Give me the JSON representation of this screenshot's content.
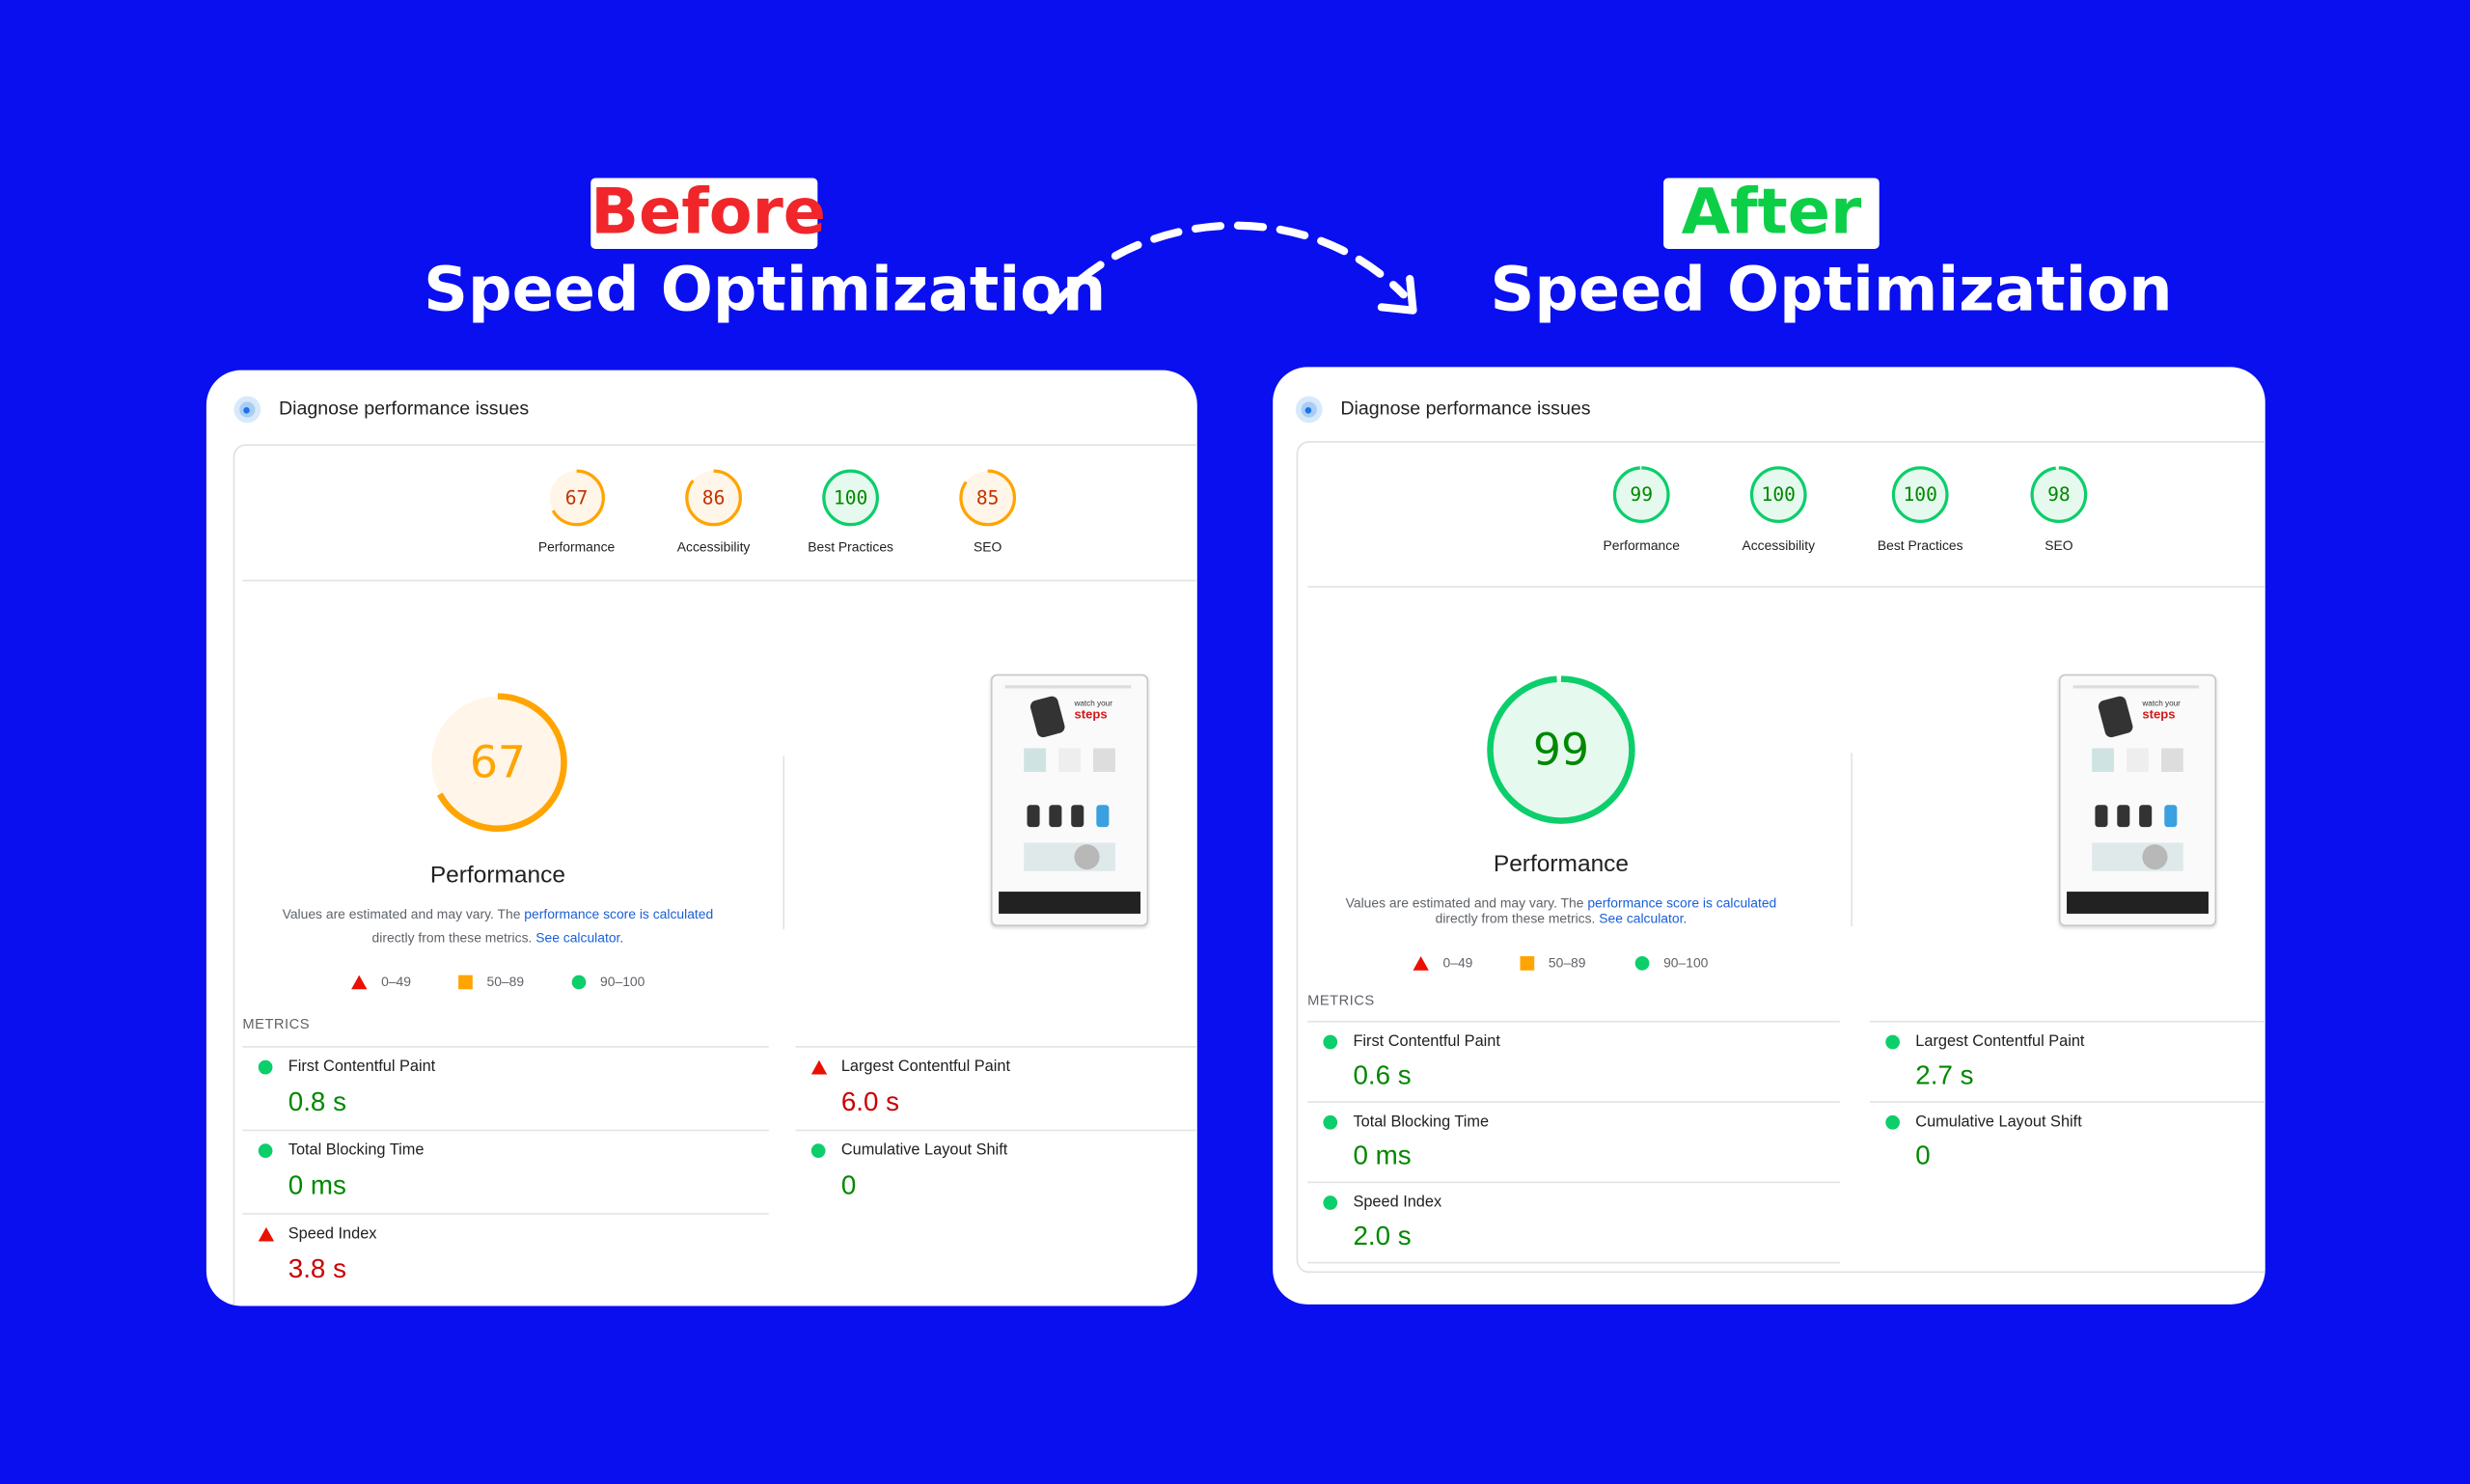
{
  "colors": {
    "background": "#0a0ff0",
    "before_badge": "#f0262b",
    "after_badge": "#0ccf47",
    "good": "#0cce6b",
    "average": "#ffa400",
    "poor": "#eb0f00",
    "good_text": "#008800",
    "poor_text": "#cc0000",
    "average_text": "#c33300",
    "link": "#1a5fd6"
  },
  "banner": {
    "before_badge": "Before",
    "before_title": "Speed Optimization",
    "after_badge": "After",
    "after_title": "Speed Optimization",
    "arrow_icon": "dashed-curved-arrow"
  },
  "before": {
    "header": "Diagnose performance issues",
    "header_icon": "pagespeed-icon",
    "categories": [
      {
        "label": "Performance",
        "score": 67,
        "status": "average"
      },
      {
        "label": "Accessibility",
        "score": 86,
        "status": "average"
      },
      {
        "label": "Best Practices",
        "score": 100,
        "status": "good"
      },
      {
        "label": "SEO",
        "score": 85,
        "status": "average"
      }
    ],
    "main_score": 67,
    "main_status": "average",
    "main_label": "Performance",
    "desc_1": "Values are estimated and may vary. The ",
    "desc_link_1": "performance score is calculated",
    "desc_2": "directly from these metrics. ",
    "desc_link_2": "See calculator.",
    "legend": [
      "0–49",
      "50–89",
      "90–100"
    ],
    "metrics_heading": "METRICS",
    "metrics": [
      {
        "label": "First Contentful Paint",
        "value": "0.8 s",
        "status": "good"
      },
      {
        "label": "Largest Contentful Paint",
        "value": "6.0 s",
        "status": "poor"
      },
      {
        "label": "Total Blocking Time",
        "value": "0 ms",
        "status": "good"
      },
      {
        "label": "Cumulative Layout Shift",
        "value": "0",
        "status": "good"
      },
      {
        "label": "Speed Index",
        "value": "3.8 s",
        "status": "poor"
      }
    ],
    "thumb_text": {
      "line1": "watch your",
      "line2": "steps"
    }
  },
  "after": {
    "header": "Diagnose performance issues",
    "header_icon": "pagespeed-icon",
    "categories": [
      {
        "label": "Performance",
        "score": 99,
        "status": "good"
      },
      {
        "label": "Accessibility",
        "score": 100,
        "status": "good"
      },
      {
        "label": "Best Practices",
        "score": 100,
        "status": "good"
      },
      {
        "label": "SEO",
        "score": 98,
        "status": "good"
      }
    ],
    "main_score": 99,
    "main_status": "good",
    "main_label": "Performance",
    "desc_1": "Values are estimated and may vary. The ",
    "desc_link_1": "performance score is calculated",
    "desc_2": "directly from these metrics. ",
    "desc_link_2": "See calculator.",
    "legend": [
      "0–49",
      "50–89",
      "90–100"
    ],
    "metrics_heading": "METRICS",
    "metrics": [
      {
        "label": "First Contentful Paint",
        "value": "0.6 s",
        "status": "good"
      },
      {
        "label": "Largest Contentful Paint",
        "value": "2.7 s",
        "status": "good"
      },
      {
        "label": "Total Blocking Time",
        "value": "0 ms",
        "status": "good"
      },
      {
        "label": "Cumulative Layout Shift",
        "value": "0",
        "status": "good"
      },
      {
        "label": "Speed Index",
        "value": "2.0 s",
        "status": "good"
      }
    ],
    "thumb_text": {
      "line1": "watch your",
      "line2": "steps"
    }
  }
}
